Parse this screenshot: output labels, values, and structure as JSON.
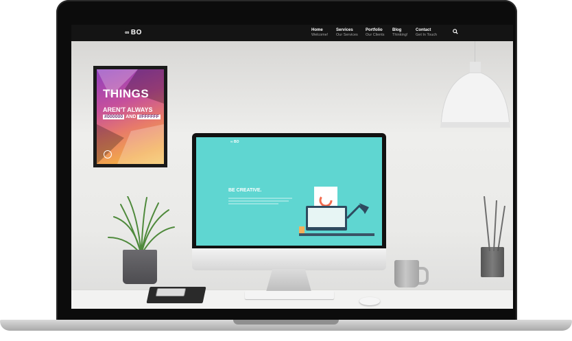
{
  "navbar": {
    "logo": "BO",
    "items": [
      {
        "title": "Home",
        "subtitle": "Welcome!"
      },
      {
        "title": "Services",
        "subtitle": "Our Services"
      },
      {
        "title": "Portfolio",
        "subtitle": "Our Clients"
      },
      {
        "title": "Blog",
        "subtitle": "Thinking!"
      },
      {
        "title": "Contact",
        "subtitle": "Get In Touch"
      }
    ],
    "search_icon": "search-icon"
  },
  "poster": {
    "line1": "THINGS",
    "line2": "AREN'T ALWAYS",
    "code1": "#000000",
    "and": "AND",
    "code2": "#FFFFFF"
  },
  "imac_site": {
    "logo": "BO",
    "headline": "BE CREATIVE."
  },
  "colors": {
    "navbar": "#141414",
    "imac_screen": "#5fd6d1",
    "poster_gradient_start": "#8e3fbf",
    "poster_gradient_end": "#f5c35a"
  }
}
